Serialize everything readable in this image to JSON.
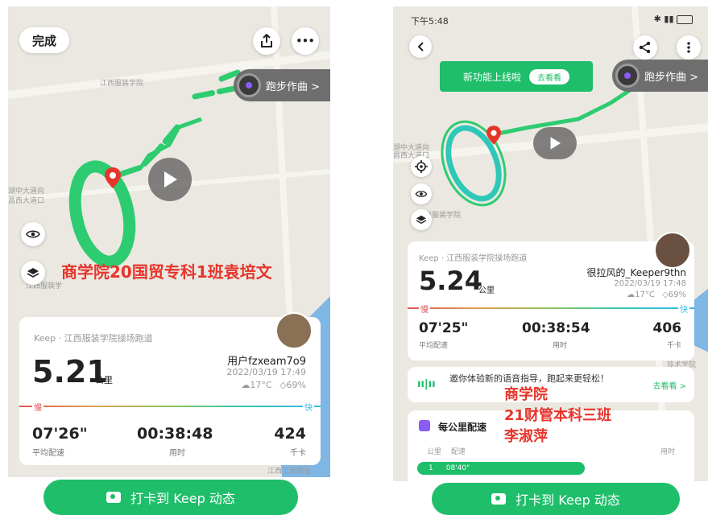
{
  "left": {
    "top_bar": {
      "done_label": "完成",
      "share_icon": "share-icon",
      "more_label": "•••"
    },
    "music": {
      "label": "跑步作曲 >"
    },
    "map_labels": [
      "江西服装学院",
      "湖中大道向",
      "昌西大道口",
      "江西服装学",
      "江西工商职业"
    ],
    "annotation": "商学院20国贸专科1班袁培文",
    "card": {
      "source": "Keep · 江西服装学院操场跑道",
      "distance": "5.21",
      "unit": "公里",
      "username": "用户fzxeam7o9",
      "datetime": "2022/03/19 17:49",
      "temperature": "17°C",
      "humidity": "69%",
      "slow_label": "慢",
      "fast_label": "快",
      "pace_value": "07'26\"",
      "pace_label": "平均配速",
      "time_value": "00:38:48",
      "time_label": "用时",
      "cal_value": "424",
      "cal_label": "千卡"
    },
    "cta_label": "打卡到 Keep 动态"
  },
  "right": {
    "status": {
      "time": "下午5:48"
    },
    "new_feature": {
      "text": "新功能上线啦",
      "button": "去看看"
    },
    "music": {
      "label": "跑步作曲 >"
    },
    "map_labels": [
      "湖中大道向",
      "昌西大道口",
      "江西服装学院",
      "技术学院"
    ],
    "card": {
      "source": "Keep · 江西服装学院操场跑道",
      "distance": "5.24",
      "unit": "公里",
      "username": "很拉风的_Keeper9thn",
      "datetime": "2022/03/19 17:48",
      "temperature": "17°C",
      "humidity": "69%",
      "slow_label": "慢",
      "fast_label": "快",
      "pace_value": "07'25\"",
      "pace_label": "平均配速",
      "time_value": "00:38:54",
      "time_label": "用时",
      "cal_value": "406",
      "cal_label": "千卡"
    },
    "voice_banner": {
      "text": "邀你体验新的语音指导，跑起来更轻松！",
      "link": "去看看 >"
    },
    "annotation_lines": [
      "商学院",
      "21财管本科三班",
      "李淑萍"
    ],
    "per_km": {
      "title": "每公里配速",
      "col_km": "公里",
      "col_pace": "配速",
      "col_time": "用时",
      "rows": [
        {
          "km": "1",
          "pace": "08'40\""
        }
      ]
    },
    "cta_label": "打卡到 Keep 动态"
  },
  "colors": {
    "accent": "#1ebe6a",
    "route": "#2ecc71",
    "annotation": "#e6352b"
  }
}
